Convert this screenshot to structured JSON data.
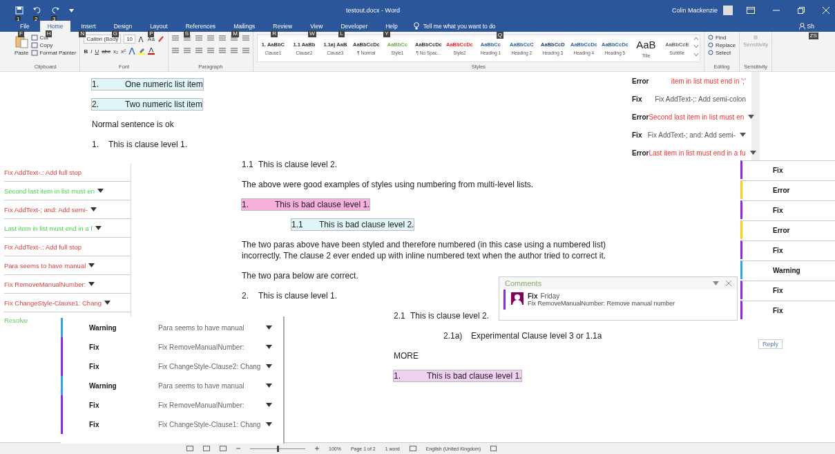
{
  "window": {
    "title": "testout.docx - Word",
    "user": "Colin Mackenzie",
    "quick_access": [
      {
        "keytip": "1"
      },
      {
        "keytip": "2"
      },
      {
        "keytip": "3"
      }
    ]
  },
  "tabs": [
    {
      "label": "File",
      "keytip": "F",
      "selected": false
    },
    {
      "label": "Home",
      "keytip": "H",
      "selected": true
    },
    {
      "label": "Insert",
      "keytip": "N",
      "selected": false
    },
    {
      "label": "Design",
      "keytip": "G",
      "selected": false
    },
    {
      "label": "Layout",
      "keytip": "P",
      "selected": false
    },
    {
      "label": "References",
      "keytip": "S",
      "selected": false
    },
    {
      "label": "Mailings",
      "keytip": "M",
      "selected": false
    },
    {
      "label": "Review",
      "keytip": "R",
      "selected": false
    },
    {
      "label": "View",
      "keytip": "W",
      "selected": false
    },
    {
      "label": "Developer",
      "keytip": "L",
      "selected": false
    },
    {
      "label": "Help",
      "keytip": "Y",
      "selected": false
    }
  ],
  "tell_me": {
    "placeholder": "Tell me what you want to do",
    "keytip": "Q"
  },
  "share": {
    "label": "Sh",
    "keytip": "ZS"
  },
  "ribbon": {
    "clipboard": {
      "paste": "Paste",
      "cut": "Cut",
      "copy": "Copy",
      "format_painter": "Format Painter",
      "label": "Clipboard"
    },
    "font": {
      "font_name": "Calibri (Body",
      "font_size": "10",
      "case": "Aa",
      "format_buttons": [
        "B",
        "I",
        "U",
        "abc",
        "x₂",
        "x²"
      ],
      "label": "Font"
    },
    "paragraph": {
      "label": "Paragraph"
    },
    "styles": {
      "label": "Styles",
      "items": [
        {
          "preview": "1. AaBbC",
          "name": "Clause1",
          "color": "#333333"
        },
        {
          "preview": "1.1 AaBb",
          "name": "Clause2",
          "color": "#333333"
        },
        {
          "preview": "1.1a) AaB",
          "name": "Clause3",
          "color": "#333333"
        },
        {
          "preview": "AaBbCcDc",
          "name": "¶ Normal",
          "color": "#333333"
        },
        {
          "preview": "AaBbCc",
          "name": "Style1",
          "color": "#70b050"
        },
        {
          "preview": "AaBbCcDc",
          "name": "¶ No Spac...",
          "color": "#333333"
        },
        {
          "preview": "AaBbCcDc",
          "name": "Style2",
          "color": "#ff2020"
        },
        {
          "preview": "AaBbCc",
          "name": "Heading 1",
          "color": "#2e5fa8"
        },
        {
          "preview": "AaBbCcC",
          "name": "Heading 2",
          "color": "#2e5fa8"
        },
        {
          "preview": "AaBbCcD",
          "name": "Heading 3",
          "color": "#1f3f78"
        },
        {
          "preview": "AaBbCcDc",
          "name": "Heading 4",
          "color": "#2e5fa8"
        },
        {
          "preview": "AaBbCcDc",
          "name": "Heading 5",
          "color": "#2e5fa8"
        },
        {
          "preview": "AaB",
          "name": "Title",
          "color": "#222222"
        },
        {
          "preview": "AaBbCcE",
          "name": "Subtitle",
          "color": "#666666"
        }
      ]
    },
    "editing": {
      "find": "Find",
      "replace": "Replace",
      "select": "Select",
      "label": "Editing"
    },
    "sensitivity": {
      "button": "Sensitivity",
      "label": "Sensitivity"
    }
  },
  "document": {
    "upper": [
      {
        "kind": "list",
        "number": "1.",
        "text": "One numeric list item",
        "color": "#dff5f7"
      },
      {
        "kind": "list",
        "number": "2.",
        "text": "Two numeric list item",
        "color": "#dff5f7"
      },
      {
        "kind": "text",
        "text": "Normal sentence is ok"
      },
      {
        "kind": "list",
        "number": "1.",
        "text": "This is clause level 1."
      }
    ],
    "middle": [
      {
        "kind": "list",
        "number": "1.1",
        "text": "This is clause level 2."
      },
      {
        "kind": "text",
        "text": "The above were good examples of styles using numbering from multi-level lists."
      },
      {
        "kind": "list",
        "number": "1.",
        "text": "This is bad clause level 1.",
        "color": "#f7b0dc"
      },
      {
        "kind": "sublist",
        "number": "1.1",
        "text": "This is bad clause level 2.",
        "color": "#dff5f7"
      },
      {
        "kind": "text",
        "text": "The two paras above have been styled and therefore numbered (in this case using a numbered list) incorrectly. The clause 2 ever ended up with inline numbered text when the author tried to correct it."
      },
      {
        "kind": "text",
        "text": "The two para below are correct."
      },
      {
        "kind": "list",
        "number": "2.",
        "text": "This is clause level 1."
      }
    ],
    "lower": [
      {
        "kind": "list",
        "number": "2.1",
        "text": "This is clause level 2."
      },
      {
        "kind": "sublist",
        "number": "2.1a)",
        "text": "Experimental Clause level 3 or 1.1a"
      },
      {
        "kind": "text",
        "text": "MORE"
      },
      {
        "kind": "list",
        "number": "1.",
        "text": "This is bad clause level 1.",
        "color": "#f0d0f0"
      }
    ]
  },
  "right_pane": {
    "rows": [
      {
        "kind": "error",
        "label": "Error",
        "text": "item in list must end in ';'",
        "dropdown": false
      },
      {
        "kind": "fix",
        "label": "Fix",
        "text": "Fix AddText-;: Add semi-colon",
        "dropdown": false
      },
      {
        "kind": "error",
        "label": "Error",
        "text": "Second last item in list must en",
        "dropdown": true
      },
      {
        "kind": "fix",
        "label": "Fix",
        "text": "Fix AddText-; and: Add semi-",
        "dropdown": true
      },
      {
        "kind": "error",
        "label": "Error",
        "text": "Last item in list must end in a fu",
        "dropdown": true
      }
    ]
  },
  "right_column": {
    "items": [
      {
        "kind": "fix",
        "label": "Fix"
      },
      {
        "kind": "error",
        "label": "Error"
      },
      {
        "kind": "fix",
        "label": "Fix"
      },
      {
        "kind": "error",
        "label": "Error"
      },
      {
        "kind": "fix",
        "label": "Fix"
      },
      {
        "kind": "warning",
        "label": "Warning"
      },
      {
        "kind": "fix",
        "label": "Fix"
      },
      {
        "kind": "fix",
        "label": "Fix"
      }
    ]
  },
  "left_panel": {
    "items": [
      {
        "kind": "fix",
        "text": "Fix AddText-.: Add full stop",
        "dropdown": false
      },
      {
        "kind": "error",
        "text": "Second last item in list must en",
        "dropdown": true
      },
      {
        "kind": "fix",
        "text": "Fix AddText-; and: Add semi-",
        "dropdown": true
      },
      {
        "kind": "error",
        "text": "Last item in list must end in a f",
        "dropdown": true
      },
      {
        "kind": "fix",
        "text": "Fix AddText-.: Add full stop",
        "dropdown": false
      },
      {
        "kind": "warning",
        "text": "Para seems to have manual",
        "dropdown": true
      },
      {
        "kind": "fix",
        "text": "Fix RemoveManualNumber:",
        "dropdown": true
      },
      {
        "kind": "fix",
        "text": "Fix ChangeStyle-Clause1: Chang",
        "dropdown": true
      }
    ],
    "resolve": "Resolve"
  },
  "bottom_panel": {
    "rows": [
      {
        "kind": "warning",
        "label": "Warning",
        "text": "Para seems to have manual",
        "dropdown": true
      },
      {
        "kind": "fix",
        "label": "Fix",
        "text": "Fix RemoveManualNumber:",
        "dropdown": true
      },
      {
        "kind": "fix",
        "label": "Fix",
        "text": "Fix ChangeStyle-Clause2: Chang",
        "dropdown": true
      },
      {
        "kind": "warning",
        "label": "Warning",
        "text": "Para seems to have manual",
        "dropdown": true
      },
      {
        "kind": "fix",
        "label": "Fix",
        "text": "Fix RemoveManualNumber:",
        "dropdown": true
      },
      {
        "kind": "fix",
        "label": "Fix",
        "text": "Fix ChangeStyle-Clause1: Chang",
        "dropdown": true
      }
    ]
  },
  "comments_popup": {
    "title": "Comments",
    "author": "Fix",
    "time": "Friday",
    "text": "Fix RemoveManualNumber: Remove manual number",
    "reply": "Reply"
  },
  "status_bar": {
    "zoom": {
      "level": 0.5,
      "reading": "100%"
    },
    "page": "Page 1 of 2",
    "words": "1 word",
    "language": "English (United Kingdom)"
  }
}
